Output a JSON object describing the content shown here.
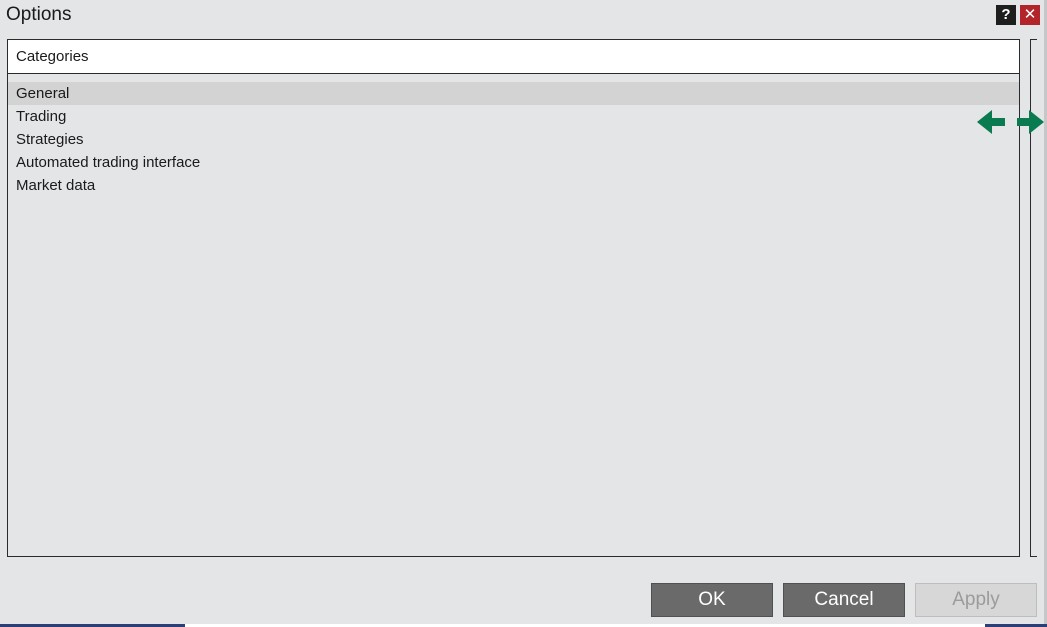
{
  "window": {
    "title": "Options",
    "help_label": "?",
    "close_label": "✕"
  },
  "categories": {
    "header": "Categories",
    "items": [
      {
        "label": "General",
        "selected": true
      },
      {
        "label": "Trading",
        "selected": false
      },
      {
        "label": "Strategies",
        "selected": false
      },
      {
        "label": "Automated trading interface",
        "selected": false
      },
      {
        "label": "Market data",
        "selected": false
      }
    ]
  },
  "buttons": {
    "ok": "OK",
    "cancel": "Cancel",
    "apply": "Apply"
  },
  "colors": {
    "accent_arrow": "#0a7a50",
    "close_red": "#b3242a",
    "button_gray": "#6a6a6a",
    "disabled_button": "#d7d7d7"
  },
  "icons": {
    "help": "help-icon",
    "close": "close-icon",
    "resize": "resize-horizontal-icon"
  }
}
